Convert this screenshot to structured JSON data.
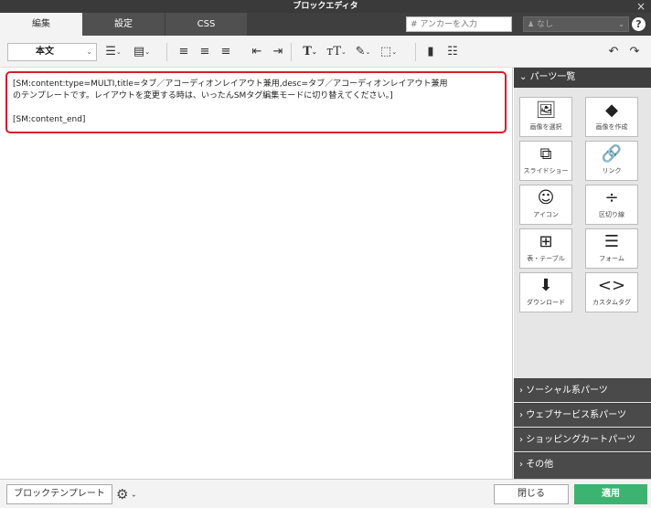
{
  "window": {
    "title": "ブロックエディタ",
    "close_icon": "×"
  },
  "tabs": [
    {
      "label": "編集",
      "active": true
    },
    {
      "label": "設定",
      "active": false
    },
    {
      "label": "CSS",
      "active": false
    }
  ],
  "anchor": {
    "placeholder": "# アンカーを入力",
    "select_value": "なし"
  },
  "toolbar": {
    "style_value": "本文",
    "undo_icon": "↶",
    "redo_icon": "↷"
  },
  "editor": {
    "line1": "[SM:content:type=MULTI,title=タブ／アコーディオンレイアウト兼用,desc=タブ／アコーディオンレイアウト兼用",
    "line2": "のテンプレートです。レイアウトを変更する時は、いったんSMタグ編集モードに切り替えてください。]",
    "line3": "",
    "line4": "[SM:content_end]"
  },
  "sidebar": {
    "header": "パーツ一覧",
    "parts": [
      {
        "label": "画像を選択",
        "icon": "image-icon"
      },
      {
        "label": "画像を作成",
        "icon": "shapes-icon"
      },
      {
        "label": "スライドショー",
        "icon": "slideshow-icon"
      },
      {
        "label": "リンク",
        "icon": "link-icon"
      },
      {
        "label": "アイコン",
        "icon": "smiley-icon"
      },
      {
        "label": "区切り線",
        "icon": "divider-icon"
      },
      {
        "label": "表・テーブル",
        "icon": "table-icon"
      },
      {
        "label": "フォーム",
        "icon": "form-icon"
      },
      {
        "label": "ダウンロード",
        "icon": "download-icon"
      },
      {
        "label": "カスタムタグ",
        "icon": "code-icon"
      }
    ],
    "categories": [
      "ソーシャル系パーツ",
      "ウェブサービス系パーツ",
      "ショッピングカートパーツ",
      "その他"
    ]
  },
  "footer": {
    "template_button": "ブロックテンプレート",
    "close_button": "閉じる",
    "apply_button": "適用"
  },
  "colors": {
    "accent": "#3cb371",
    "highlight_border": "#d0202c",
    "dark": "#3f3f3f"
  }
}
